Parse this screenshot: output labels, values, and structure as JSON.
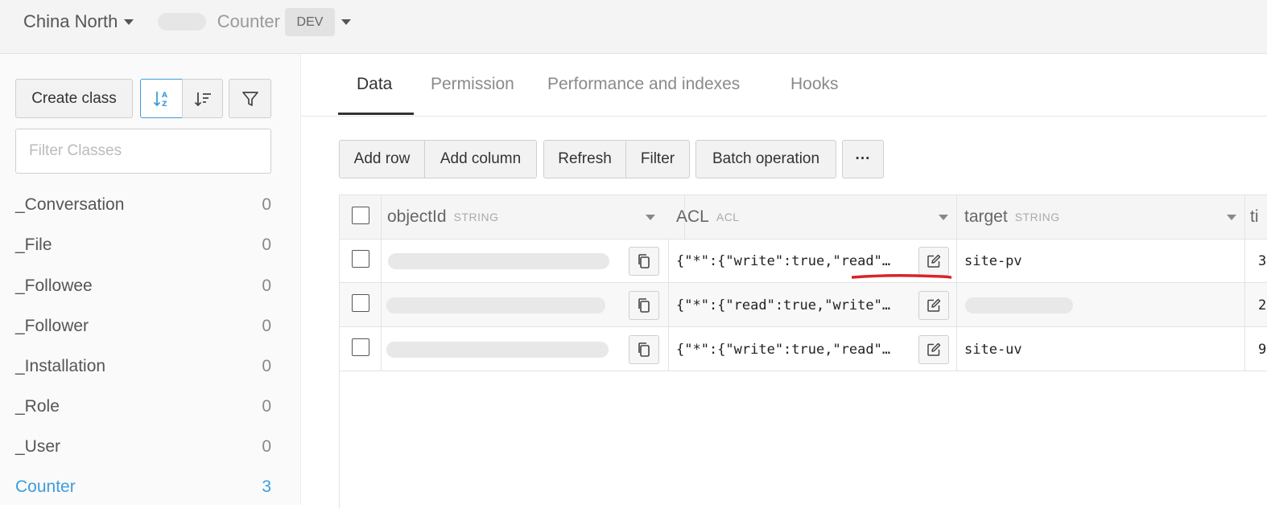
{
  "topbar": {
    "region": "China North",
    "app_name": "Counter",
    "env": "DEV"
  },
  "sidebar": {
    "create_class": "Create class",
    "filter_placeholder": "Filter Classes",
    "classes": [
      {
        "name": "_Conversation",
        "count": "0"
      },
      {
        "name": "_File",
        "count": "0"
      },
      {
        "name": "_Followee",
        "count": "0"
      },
      {
        "name": "_Follower",
        "count": "0"
      },
      {
        "name": "_Installation",
        "count": "0"
      },
      {
        "name": "_Role",
        "count": "0"
      },
      {
        "name": "_User",
        "count": "0"
      },
      {
        "name": "Counter",
        "count": "3"
      }
    ]
  },
  "tabs": [
    "Data",
    "Permission",
    "Performance and indexes",
    "Hooks"
  ],
  "toolbar": {
    "add_row": "Add row",
    "add_column": "Add column",
    "refresh": "Refresh",
    "filter": "Filter",
    "batch": "Batch operation",
    "more": "···"
  },
  "table": {
    "columns": [
      {
        "name": "objectId",
        "type": "STRING"
      },
      {
        "name": "ACL",
        "type": "ACL"
      },
      {
        "name": "target",
        "type": "STRING"
      },
      {
        "name": "ti",
        "type": ""
      }
    ],
    "rows": [
      {
        "acl": "{\"*\":{\"write\":true,\"read\"…",
        "target": "site-pv",
        "last": "3"
      },
      {
        "acl": "{\"*\":{\"read\":true,\"write\"…",
        "target": "",
        "last": "2"
      },
      {
        "acl": "{\"*\":{\"write\":true,\"read\"…",
        "target": "site-uv",
        "last": "9"
      }
    ]
  },
  "colors": {
    "accent": "#3d9ddc",
    "annotation": "#d9232a"
  }
}
